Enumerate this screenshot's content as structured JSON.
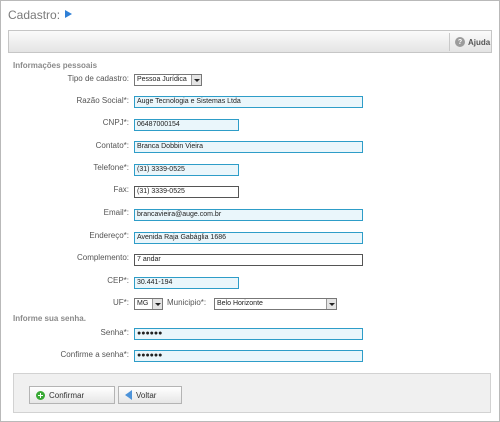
{
  "header": {
    "title": "Cadastro:"
  },
  "toolbar": {
    "help_label": "Ajuda"
  },
  "sections": {
    "personal": "Informações pessoais",
    "password": "Informe sua senha."
  },
  "form": {
    "tipo": {
      "label": "Tipo de cadastro:",
      "value": "Pessoa Jurídica"
    },
    "razao": {
      "label": "Razão Social*:",
      "value": "Auge Tecnologia e Sistemas Ltda"
    },
    "cnpj": {
      "label": "CNPJ*:",
      "value": "06487000154"
    },
    "contato": {
      "label": "Contato*:",
      "value": "Branca Dobbin Vieira"
    },
    "telefone": {
      "label": "Telefone*:",
      "value": "(31) 3339-0525"
    },
    "fax": {
      "label": "Fax:",
      "value": "(31) 3339-0525"
    },
    "email": {
      "label": "Email*:",
      "value": "brancavieira@auge.com.br"
    },
    "endereco": {
      "label": "Endereço*:",
      "value": "Avenida Raja Gabáglia 1686"
    },
    "complemento": {
      "label": "Complemento:",
      "value": "7 andar"
    },
    "cep": {
      "label": "CEP*:",
      "value": "30.441-194"
    },
    "uf": {
      "label": "UF*:",
      "value": "MG"
    },
    "municipio": {
      "label": "Municipio*:",
      "value": "Belo Horizonte"
    },
    "senha": {
      "label": "Senha*:",
      "value": "●●●●●●"
    },
    "confirma": {
      "label": "Confirme a senha*:",
      "value": "●●●●●●"
    }
  },
  "buttons": {
    "confirm": "Confirmar",
    "back": "Voltar"
  },
  "icons": {
    "title": "arrow-right-icon",
    "help": "help-icon",
    "confirm": "plus-circle-icon",
    "back": "arrow-left-icon"
  },
  "colors": {
    "field_border": "#2e9dc8",
    "field_bg": "#eaf6fb",
    "accent": "#2f7fd6"
  }
}
